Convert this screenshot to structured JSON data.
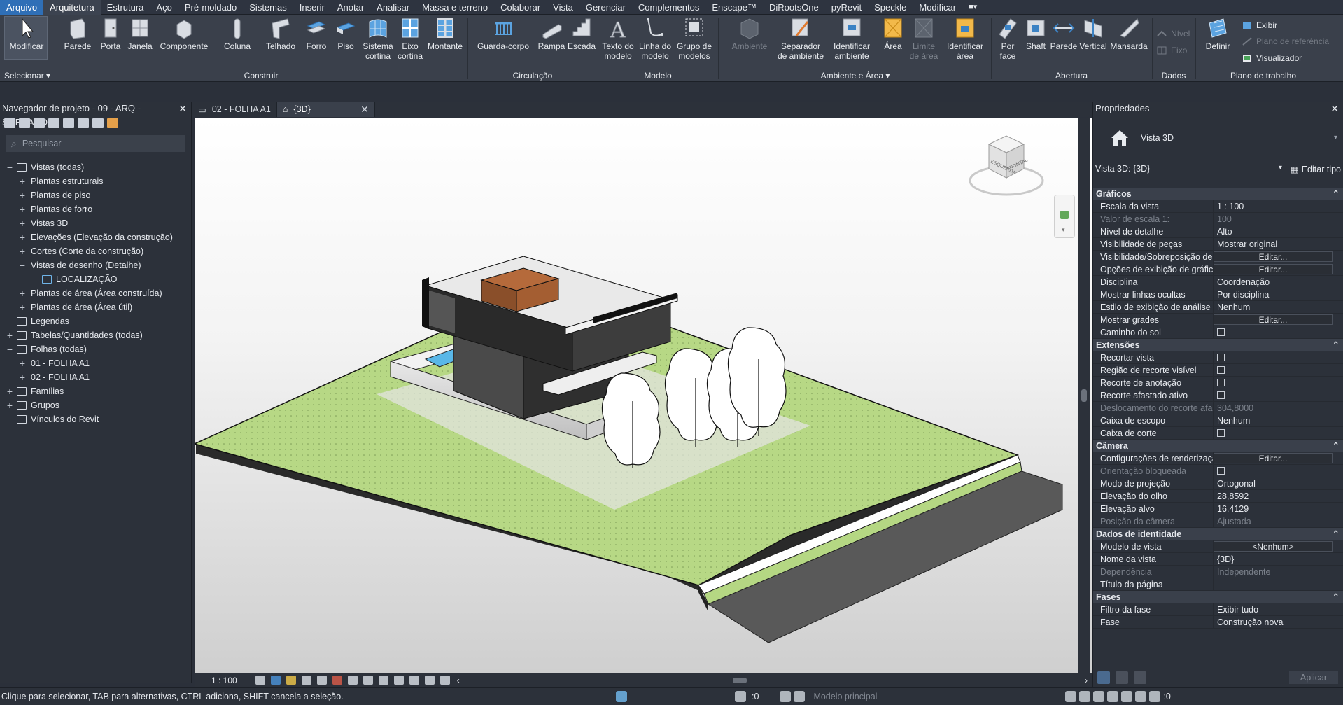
{
  "menu": [
    "Arquivo",
    "Arquitetura",
    "Estrutura",
    "Aço",
    "Pré-moldado",
    "Sistemas",
    "Inserir",
    "Anotar",
    "Analisar",
    "Massa e terreno",
    "Colaborar",
    "Vista",
    "Gerenciar",
    "Complementos",
    "Enscape™",
    "DiRootsOne",
    "pyRevit",
    "Speckle",
    "Modificar"
  ],
  "ribbon": {
    "modify": "Modificar",
    "select": "Selecionar",
    "build": {
      "group": "Construir",
      "items": [
        "Parede",
        "Porta",
        "Janela",
        "Componente",
        "Coluna",
        "Telhado",
        "Forro",
        "Piso",
        "Sistema\ncortina",
        "Eixo\ncortina",
        "Montante"
      ]
    },
    "circulation": {
      "group": "Circulação",
      "items": [
        "Guarda-corpo",
        "Rampa",
        "Escada"
      ]
    },
    "model": {
      "group": "Modelo",
      "items": [
        "Texto do\nmodelo",
        "Linha do\nmodelo",
        "Grupo de\nmodelos"
      ]
    },
    "rooms": {
      "group": "Ambiente e Área",
      "items": [
        "Ambiente",
        "Separador\nde ambiente",
        "Identificar\nambiente",
        "Área",
        "Limite\nde área",
        "Identificar\nárea"
      ]
    },
    "opening": {
      "group": "Abertura",
      "items": [
        "Por\nface",
        "Shaft",
        "Parede",
        "Vertical",
        "Mansarda"
      ]
    },
    "datum": {
      "group": "Dados",
      "level": "Nível",
      "grid": "Eixo"
    },
    "workplane": {
      "group": "Plano de trabalho",
      "define": "Definir",
      "show": "Exibir",
      "refplane": "Plano de referência",
      "viewer": "Visualizador"
    }
  },
  "browser": {
    "title": "Navegador de projeto - 09 - ARQ - SOBRADO...",
    "search_placeholder": "Pesquisar",
    "tree": [
      {
        "label": "Vistas (todas)",
        "indent": 0,
        "tog": "−"
      },
      {
        "label": "Plantas estruturais",
        "indent": 1,
        "tog": "+"
      },
      {
        "label": "Plantas de piso",
        "indent": 1,
        "tog": "+"
      },
      {
        "label": "Plantas de forro",
        "indent": 1,
        "tog": "+"
      },
      {
        "label": "Vistas 3D",
        "indent": 1,
        "tog": "+"
      },
      {
        "label": "Elevações (Elevação da construção)",
        "indent": 1,
        "tog": "+"
      },
      {
        "label": "Cortes (Corte da construção)",
        "indent": 1,
        "tog": "+"
      },
      {
        "label": "Vistas de desenho (Detalhe)",
        "indent": 1,
        "tog": "−"
      },
      {
        "label": "LOCALIZAÇÃO",
        "indent": 2,
        "tog": ""
      },
      {
        "label": "Plantas de área (Área construída)",
        "indent": 1,
        "tog": "+"
      },
      {
        "label": "Plantas de área (Área útil)",
        "indent": 1,
        "tog": "+"
      },
      {
        "label": "Legendas",
        "indent": 0,
        "tog": ""
      },
      {
        "label": "Tabelas/Quantidades (todas)",
        "indent": 0,
        "tog": "+"
      },
      {
        "label": "Folhas (todas)",
        "indent": 0,
        "tog": "−"
      },
      {
        "label": "01 - FOLHA A1",
        "indent": 1,
        "tog": "+"
      },
      {
        "label": "02 - FOLHA A1",
        "indent": 1,
        "tog": "+"
      },
      {
        "label": "Famílias",
        "indent": 0,
        "tog": "+"
      },
      {
        "label": "Grupos",
        "indent": 0,
        "tog": "+"
      },
      {
        "label": "Vínculos do Revit",
        "indent": 0,
        "tog": ""
      }
    ]
  },
  "tabs": [
    "02 - FOLHA A1",
    "{3D}"
  ],
  "viewcube": {
    "left": "ESQUERDA",
    "front": "FRONTAL"
  },
  "viewbar": {
    "scale": "1 : 100"
  },
  "properties": {
    "title": "Propriedades",
    "type": "Vista 3D",
    "selector": "Vista 3D: {3D}",
    "edit_type": "Editar tipo",
    "sections": [
      {
        "name": "Gráficos",
        "rows": [
          {
            "k": "Escala da vista",
            "v": "1 : 100"
          },
          {
            "k": "Valor de escala    1:",
            "v": "100",
            "dim": true
          },
          {
            "k": "Nível de detalhe",
            "v": "Alto"
          },
          {
            "k": "Visibilidade de peças",
            "v": "Mostrar original"
          },
          {
            "k": "Visibilidade/Sobreposição de...",
            "v": "Editar...",
            "btn": true
          },
          {
            "k": "Opções de exibição de gráficos",
            "v": "Editar...",
            "btn": true
          },
          {
            "k": "Disciplina",
            "v": "Coordenação"
          },
          {
            "k": "Mostrar linhas ocultas",
            "v": "Por disciplina"
          },
          {
            "k": "Estilo de exibição de análise ...",
            "v": "Nenhum"
          },
          {
            "k": "Mostrar grades",
            "v": "Editar...",
            "btn": true
          },
          {
            "k": "Caminho do sol",
            "v": "",
            "chk": true
          }
        ]
      },
      {
        "name": "Extensões",
        "rows": [
          {
            "k": "Recortar vista",
            "v": "",
            "chk": true
          },
          {
            "k": "Região de recorte visível",
            "v": "",
            "chk": true
          },
          {
            "k": "Recorte de anotação",
            "v": "",
            "chk": true
          },
          {
            "k": "Recorte afastado ativo",
            "v": "",
            "chk": true
          },
          {
            "k": "Deslocamento do recorte afa...",
            "v": "304,8000",
            "dim": true
          },
          {
            "k": "Caixa de escopo",
            "v": "Nenhum"
          },
          {
            "k": "Caixa de corte",
            "v": "",
            "chk": true
          }
        ]
      },
      {
        "name": "Câmera",
        "rows": [
          {
            "k": "Configurações de renderização",
            "v": "Editar...",
            "btn": true
          },
          {
            "k": "Orientação bloqueada",
            "v": "",
            "chk": true,
            "dim": true
          },
          {
            "k": "Modo de projeção",
            "v": "Ortogonal"
          },
          {
            "k": "Elevação do olho",
            "v": "28,8592"
          },
          {
            "k": "Elevação alvo",
            "v": "16,4129"
          },
          {
            "k": "Posição da câmera",
            "v": "Ajustada",
            "dim": true
          }
        ]
      },
      {
        "name": "Dados de identidade",
        "rows": [
          {
            "k": "Modelo de vista",
            "v": "<Nenhum>",
            "btn": true
          },
          {
            "k": "Nome da vista",
            "v": "{3D}"
          },
          {
            "k": "Dependência",
            "v": "Independente",
            "dim": true
          },
          {
            "k": "Título da página",
            "v": ""
          }
        ]
      },
      {
        "name": "Fases",
        "rows": [
          {
            "k": "Filtro da fase",
            "v": "Exibir tudo"
          },
          {
            "k": "Fase",
            "v": "Construção nova"
          }
        ]
      }
    ],
    "apply": "Aplicar"
  },
  "status": {
    "message": "Clique para selecionar, TAB para alternativas, CTRL adiciona, SHIFT cancela a seleção.",
    "zero1": ":0",
    "model": "Modelo principal",
    "zero2": ":0"
  },
  "colors": {
    "accent": "#2f6fb7",
    "grass": "#b5d783",
    "road": "#5a5a5a"
  }
}
